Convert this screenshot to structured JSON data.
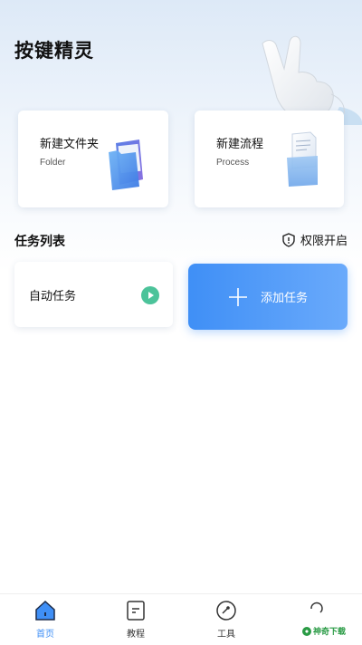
{
  "header": {
    "title": "按键精灵"
  },
  "cards": [
    {
      "title": "新建文件夹",
      "subtitle": "Folder",
      "icon": "folder-icon"
    },
    {
      "title": "新建流程",
      "subtitle": "Process",
      "icon": "process-document-icon"
    }
  ],
  "tasks": {
    "section_title": "任务列表",
    "permission_label": "权限开启",
    "auto_task_label": "自动任务",
    "add_task_label": "添加任务"
  },
  "tabs": [
    {
      "label": "首页",
      "icon": "home-icon",
      "active": true
    },
    {
      "label": "教程",
      "icon": "tutorial-icon",
      "active": false
    },
    {
      "label": "工具",
      "icon": "tools-icon",
      "active": false
    },
    {
      "label": "",
      "icon": "profile-icon",
      "active": false
    }
  ],
  "watermark": {
    "text": "神奇下载",
    "logo": "watermark-logo"
  },
  "colors": {
    "accent": "#3f8ff6",
    "play_green": "#4cc39a",
    "background_top": "#dde9f7"
  }
}
